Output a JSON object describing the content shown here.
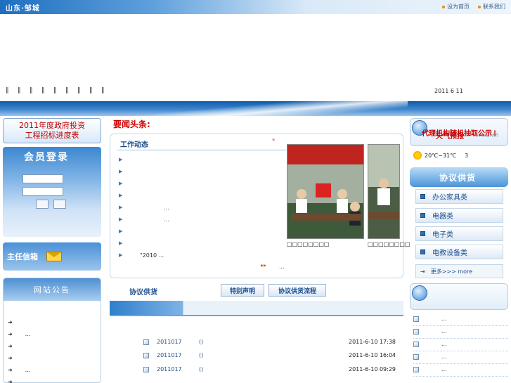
{
  "header": {
    "logo": "山东·邹城",
    "links": [
      "设为首页",
      "联系我们"
    ]
  },
  "nav": {
    "items": [
      "‖",
      "‖",
      "‖",
      "‖",
      "‖",
      "‖",
      "‖",
      "‖",
      "‖"
    ],
    "date": "2011 6 11"
  },
  "left": {
    "invest_banner": [
      "2011年度政府投资",
      "工程招标进度表"
    ],
    "login_title": "会员登录",
    "mailbox": "主任信箱",
    "notice_title": "网站公告",
    "notice_items": [
      {
        "arrow": "➜",
        "text": ""
      },
      {
        "arrow": "➜",
        "text": "..."
      },
      {
        "arrow": "➜",
        "text": ""
      },
      {
        "arrow": "➜",
        "text": ""
      },
      {
        "arrow": "➜",
        "text": "..."
      },
      {
        "arrow": "➜",
        "text": ""
      }
    ]
  },
  "center": {
    "headline_title": "要闻头条:",
    "work_tab": "工作动态",
    "quote_mark": "\"",
    "news_items": [
      {
        "text": ""
      },
      {
        "text": ""
      },
      {
        "text": ""
      },
      {
        "text": ""
      },
      {
        "text": "..."
      },
      {
        "text": "..."
      },
      {
        "text": ""
      },
      {
        "text": ""
      },
      {
        "text": "\"2010    ..."
      }
    ],
    "photo_caption_1": "□□□□□□□□",
    "photo_caption_2": "□□□□□□□□",
    "more_arrows": "▸▸",
    "more_dots": "...",
    "supply_title": "协议供货",
    "supply_tabs": [
      "特别声明",
      "协议供货流程"
    ],
    "supply_rows": [
      {
        "code": "2011017",
        "paren": "()",
        "date": "2011-6-10 17:38"
      },
      {
        "code": "2011017",
        "paren": "()",
        "date": "2011-6-10 16:04"
      },
      {
        "code": "2011017",
        "paren": "()",
        "date": "2011-6-10 09:29"
      }
    ]
  },
  "right": {
    "weather_title": "天气预报",
    "weather_en": "Weather",
    "weather_temp": "20℃~31℃",
    "weather_extra": "3",
    "supply_banner": "协议供货",
    "categories": [
      "办公家具类",
      "电器类",
      "电子类",
      "电教设备类"
    ],
    "more_label": "更多>>>  more",
    "agent_title": "代理机构随机抽取公示⇩",
    "agent_rows": [
      "...",
      "...",
      "...",
      "...",
      "..."
    ]
  }
}
